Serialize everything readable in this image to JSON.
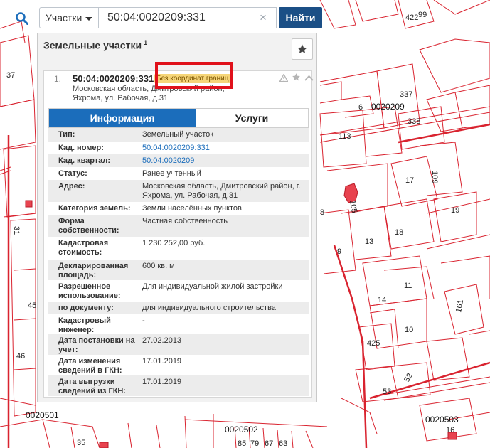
{
  "search": {
    "category": "Участки",
    "value": "50:04:0020209:331",
    "clear_glyph": "×",
    "button_label": "Найти",
    "icon": "search-icon"
  },
  "panel": {
    "title": "Земельные участки",
    "count": "1",
    "favorite_icon": "star-icon"
  },
  "result": {
    "number": "1.",
    "cadastral": "50:04:0020209:331",
    "badge": "Без координат границ",
    "address_line1": "Московская область, Дмитровский район,",
    "address_line2": "Яхрома, ул. Рабочая, д.31",
    "icons": [
      "warning-icon",
      "star-icon",
      "chevron-up-icon"
    ]
  },
  "tabs": [
    "Информация",
    "Услуги"
  ],
  "details": [
    {
      "label": "Тип:",
      "value": "Земельный участок"
    },
    {
      "label": "Кад. номер:",
      "value": "50:04:0020209:331"
    },
    {
      "label": "Кад. квартал:",
      "value": "50:04:0020209"
    },
    {
      "label": "Статус:",
      "value": "Ранее учтенный"
    },
    {
      "label": "Адрес:",
      "value": "Московская область, Дмитровский район, г. Яхрома, ул. Рабочая, д.31"
    },
    {
      "label": "Категория земель:",
      "value": "Земли населённых пунктов"
    },
    {
      "label": "Форма собственности:",
      "value": "Частная собственность"
    },
    {
      "label": "Кадастровая стоимость:",
      "value": "1 230 252,00 руб."
    },
    {
      "label": "Декларированная площадь:",
      "value": "600 кв. м"
    },
    {
      "label": "Разрешенное использование:",
      "value": "Для индивидуальной жилой застройки"
    },
    {
      "label": "по документу:",
      "value": "для индивидуального строительства"
    },
    {
      "label": "Кадастровый инженер:",
      "value": "-"
    },
    {
      "label": "Дата постановки на учет:",
      "value": "27.02.2013"
    },
    {
      "label": "Дата изменения сведений в ГКН:",
      "value": "17.01.2019"
    },
    {
      "label": "Дата выгрузки сведений из ГКН:",
      "value": "17.01.2019"
    }
  ],
  "map": {
    "labels": [
      "37",
      "422",
      "99",
      "337",
      "6",
      "0020209",
      "113",
      "338",
      "109",
      "17",
      "8",
      "105",
      "19",
      "13",
      "18",
      "9",
      "11",
      "14",
      "10",
      "161",
      "425",
      "53",
      "52",
      "45",
      "46",
      "31",
      "0020501",
      "0020502",
      "0020503",
      "16",
      "35",
      "85",
      "79",
      "67",
      "63"
    ],
    "parcel_color": "#d9232f",
    "building_color": "#e8434f"
  },
  "colors": {
    "accent": "#1b6dbb",
    "search_button": "#1b4f86",
    "badge": "#f6d679",
    "highlight": "#e0111b"
  }
}
